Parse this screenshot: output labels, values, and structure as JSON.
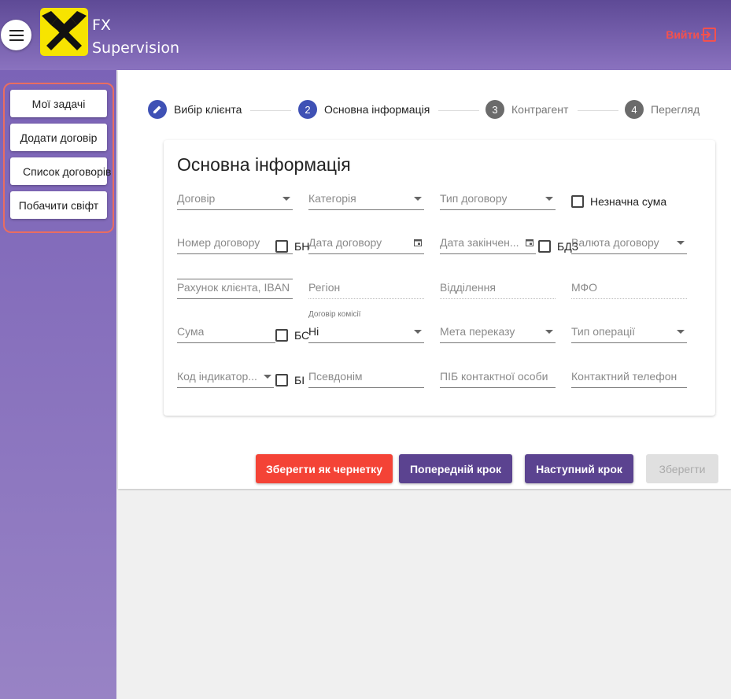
{
  "header": {
    "brand_line1": "FX",
    "brand_line2": "Supervision",
    "logout_label": "Вийти",
    "menu_icon": "hamburger-icon",
    "logo_icon": "raiffeisen-logo",
    "colors": {
      "header": "#6a55a6",
      "sidebar": "#8a72bf",
      "logout": "#f4514d"
    }
  },
  "sidebar": {
    "items": [
      {
        "label": "Мої задачі"
      },
      {
        "label": "Додати договір"
      },
      {
        "label": "Список договорів"
      },
      {
        "label": "Побачити свіфт"
      }
    ]
  },
  "stepper": {
    "steps": [
      {
        "number": "✎",
        "label": "Вибір клієнта",
        "state": "done"
      },
      {
        "number": "2",
        "label": "Основна інформація",
        "state": "active"
      },
      {
        "number": "3",
        "label": "Контрагент",
        "state": "inactive"
      },
      {
        "number": "4",
        "label": "Перегляд",
        "state": "inactive"
      }
    ]
  },
  "form": {
    "title": "Основна інформація",
    "contract": {
      "placeholder": "Договір"
    },
    "category": {
      "placeholder": "Категорія"
    },
    "contract_type": {
      "placeholder": "Тип договору"
    },
    "insignificant_sum": {
      "label": "Незначна сума",
      "checked": false
    },
    "contract_number": {
      "placeholder": "Номер договору"
    },
    "no_number": {
      "label": "БН",
      "checked": false
    },
    "contract_date": {
      "placeholder": "Дата договору"
    },
    "end_date": {
      "placeholder": "Дата закінчен..."
    },
    "no_end_date": {
      "label": "БДЗ",
      "checked": false
    },
    "currency": {
      "placeholder": "Валюта договору"
    },
    "iban": {
      "placeholder": "Рахунок клієнта, IBAN"
    },
    "region": {
      "placeholder": "Регіон"
    },
    "branch": {
      "placeholder": "Відділення"
    },
    "mfo": {
      "placeholder": "МФО"
    },
    "sum": {
      "placeholder": "Сума"
    },
    "no_sum": {
      "label": "БС",
      "checked": false
    },
    "commission": {
      "label": "Договір комісії",
      "value": "Ні"
    },
    "purpose": {
      "placeholder": "Мета переказу"
    },
    "operation_type": {
      "placeholder": "Тип операції"
    },
    "indicator_code": {
      "placeholder": "Код індикатор..."
    },
    "no_indicator": {
      "label": "БІ",
      "checked": false
    },
    "alias": {
      "placeholder": "Псевдонім"
    },
    "contact_person": {
      "placeholder": "ПІБ контактної особи"
    },
    "contact_phone": {
      "placeholder": "Контактний телефон"
    }
  },
  "actions": {
    "save_draft": "Зберегти як чернетку",
    "prev_step": "Попередній крок",
    "next_step": "Наступний крок",
    "save": "Зберегти"
  }
}
